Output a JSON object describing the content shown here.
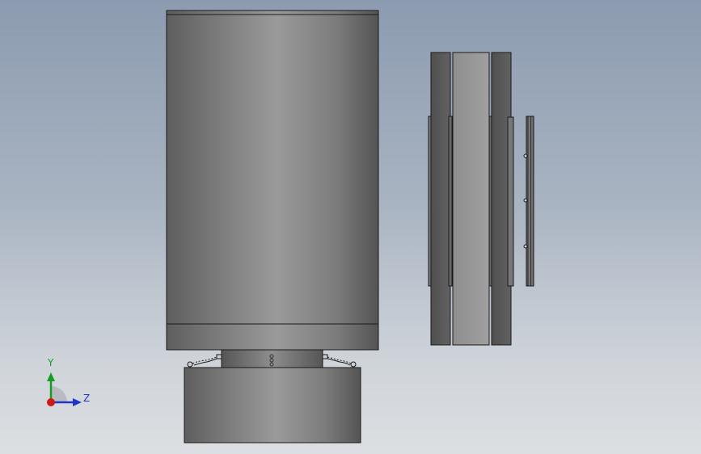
{
  "viewport": {
    "background_top": "#8c9bb0",
    "background_bottom": "#dcdfe2"
  },
  "model": {
    "front_view": {
      "parts": [
        "main-cylinder",
        "cylinder-bottom-band",
        "neck-shaft",
        "spring-clips",
        "base-cylinder"
      ]
    },
    "side_view": {
      "parts": [
        "side-outer-plate-left",
        "side-center-plate",
        "side-outer-plate-right",
        "thin-strip",
        "detached-bar"
      ]
    }
  },
  "triad": {
    "y_label": "Y",
    "z_label": "Z",
    "y_color": "#1a9a22",
    "z_color": "#1d36c9",
    "x_color": "#d01818"
  }
}
